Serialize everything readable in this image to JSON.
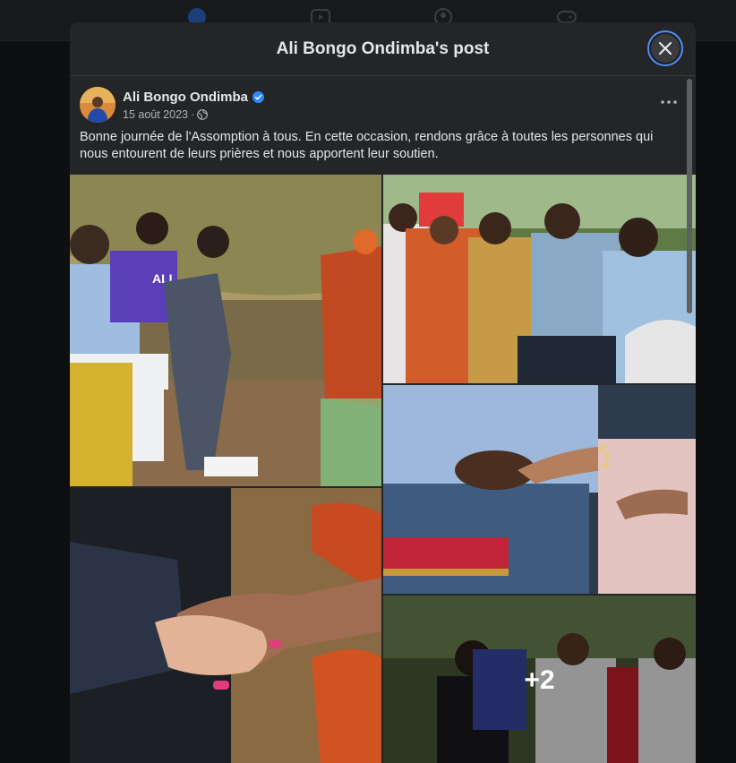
{
  "modal": {
    "title": "Ali Bongo Ondimba's post",
    "close_icon": "close-icon"
  },
  "post": {
    "author": "Ali Bongo Ondimba",
    "verified": true,
    "date": "15 août 2023",
    "separator": "·",
    "audience_icon": "globe-icon",
    "text": "Bonne journée de l'Assomption à tous. En cette occasion, rendons grâce à toutes les personnes qui nous entourent de leurs prières et nous apportent leur soutien.",
    "shirt_text": "ALI"
  },
  "gallery": {
    "photos": [
      {
        "name": "photo-1",
        "description_icon": "image"
      },
      {
        "name": "photo-2",
        "description_icon": "image"
      },
      {
        "name": "photo-3",
        "description_icon": "image"
      },
      {
        "name": "photo-4",
        "description_icon": "image"
      },
      {
        "name": "photo-5",
        "description_icon": "image"
      }
    ],
    "more_count": "+2"
  },
  "colors": {
    "background": "#242526",
    "accent": "#4d8ff5",
    "verified_blue": "#2d88ff"
  }
}
